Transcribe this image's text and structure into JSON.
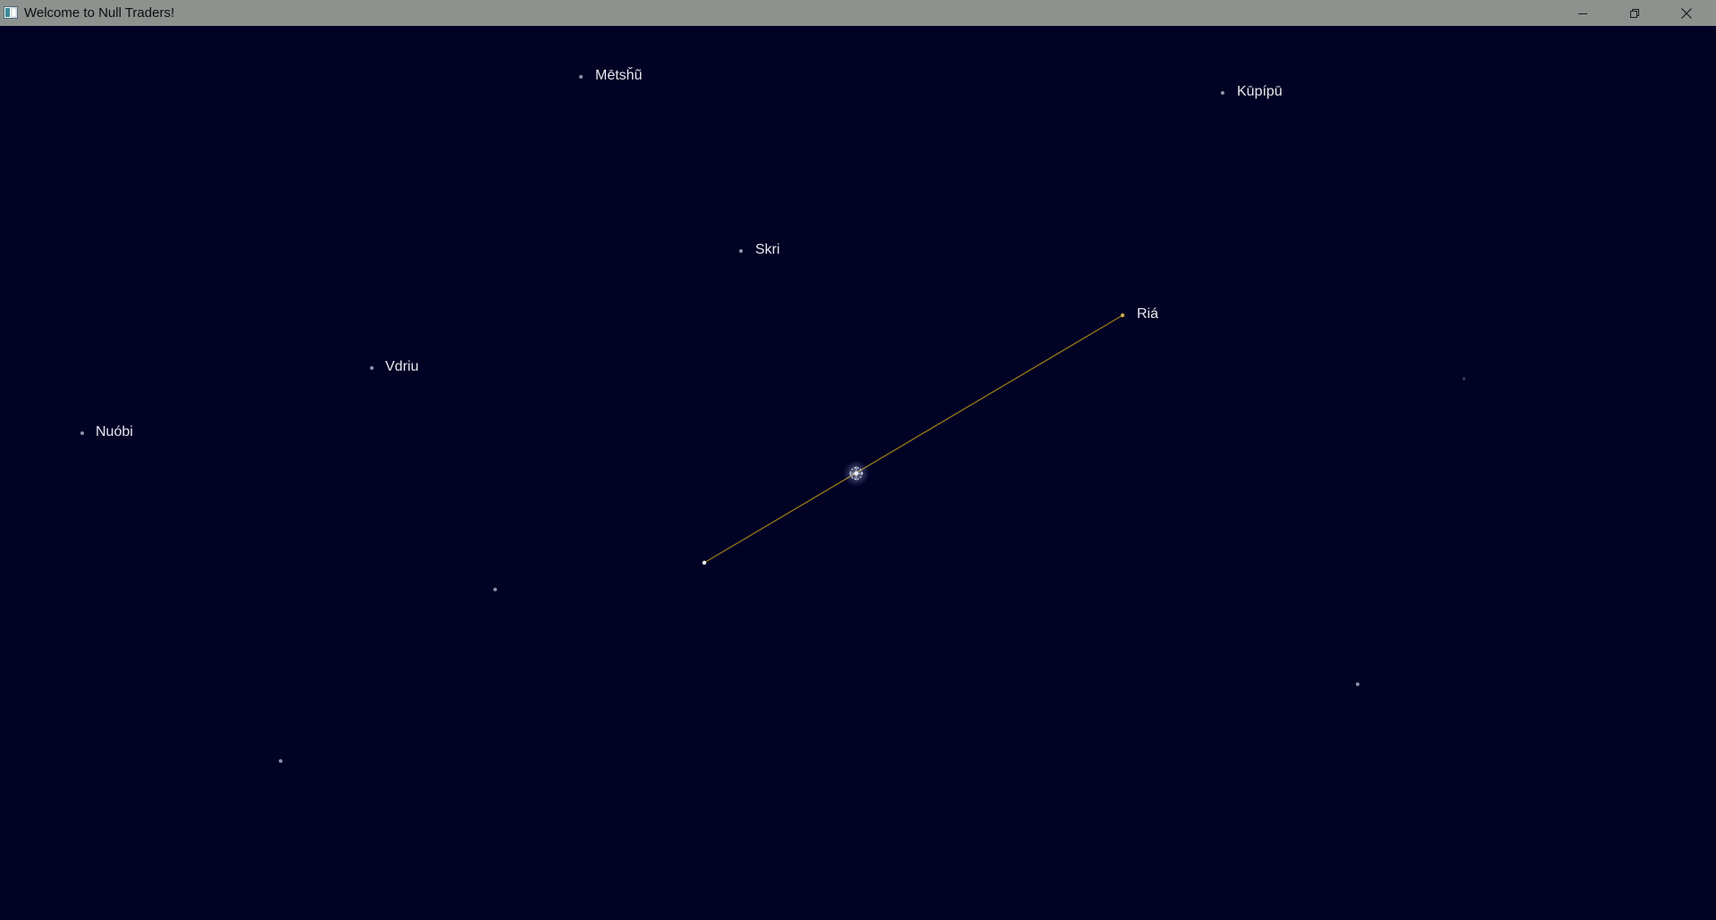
{
  "window": {
    "title": "Welcome to Null Traders!",
    "controls": {
      "minimize_icon": "minimize-icon",
      "restore_icon": "restore-icon",
      "close_icon": "close-icon"
    }
  },
  "map": {
    "background_color": "#010224",
    "route_color": "#9a7a16",
    "systems": [
      {
        "name": "Mētsȟũ"
      },
      {
        "name": "Kūpípū"
      },
      {
        "name": "Skri"
      },
      {
        "name": "Riá"
      },
      {
        "name": "Vdriu"
      },
      {
        "name": "Nuóbi"
      }
    ],
    "ship_icon": "ship-icon"
  }
}
